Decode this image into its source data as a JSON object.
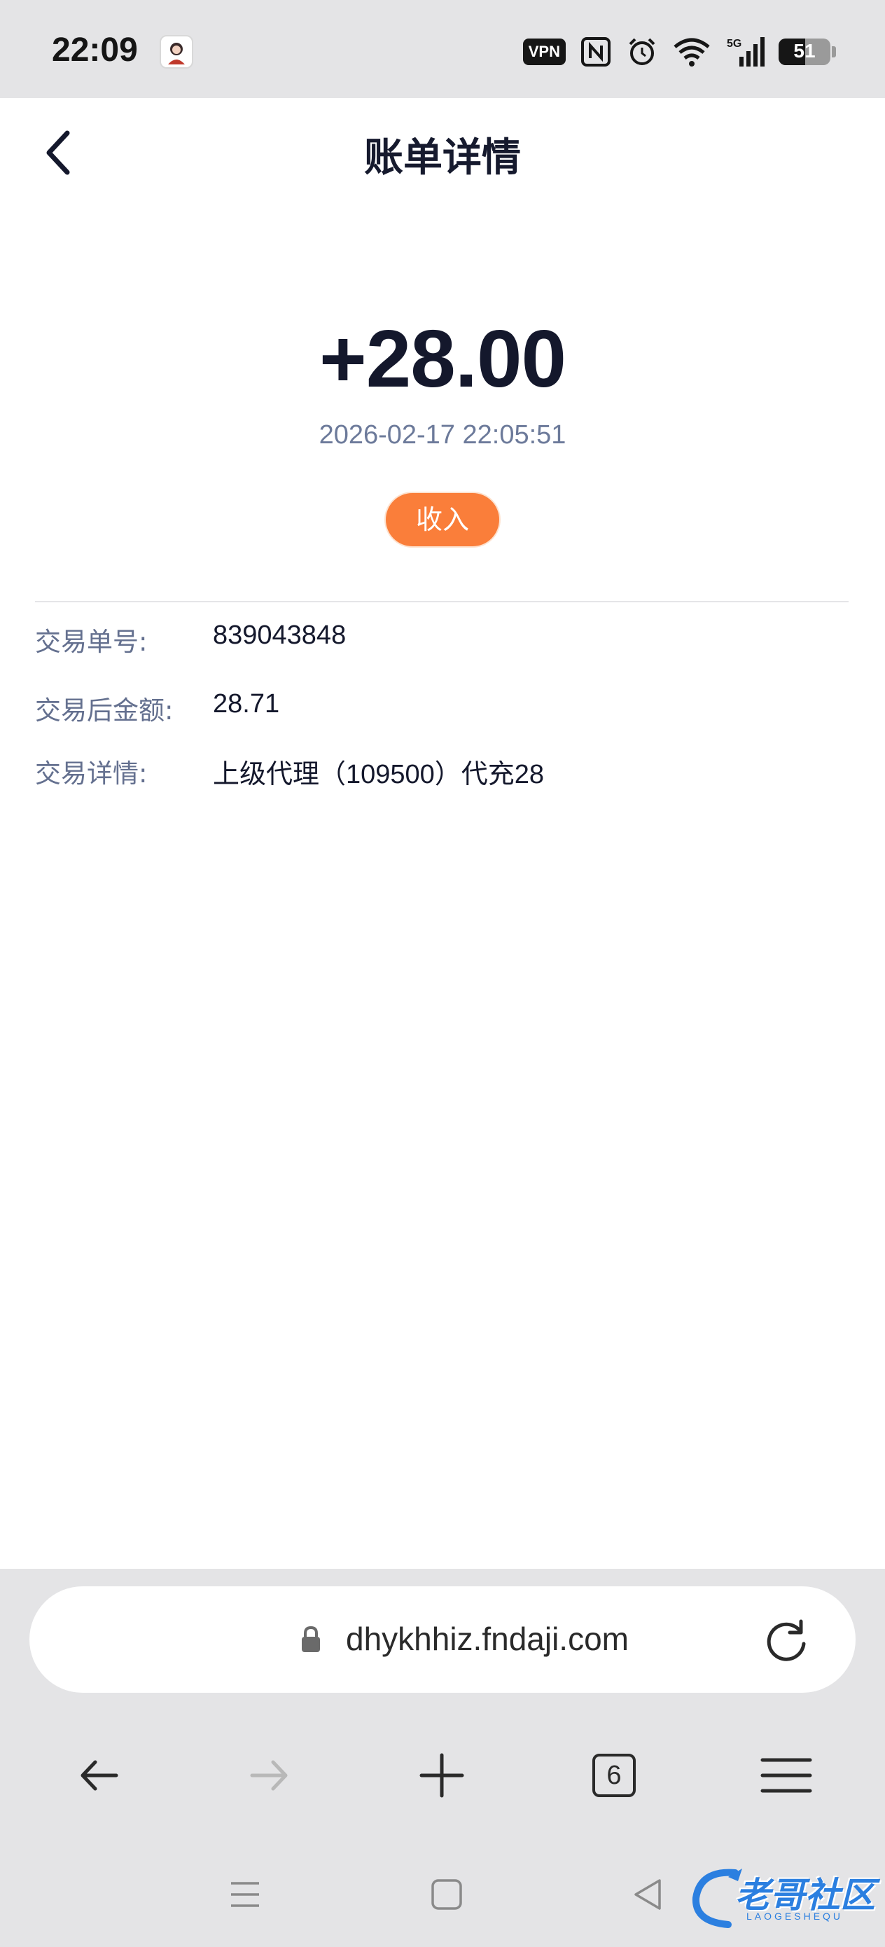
{
  "status_bar": {
    "time": "22:09",
    "vpn": "VPN",
    "network": "5G",
    "battery": "51"
  },
  "header": {
    "title": "账单详情"
  },
  "transaction": {
    "amount": "+28.00",
    "datetime": "2026-02-17 22:05:51",
    "type": "收入"
  },
  "details": [
    {
      "label": "交易单号:",
      "value": "839043848"
    },
    {
      "label": "交易后金额:",
      "value": "28.71"
    },
    {
      "label": "交易详情:",
      "value": "上级代理（109500）代充28"
    }
  ],
  "browser": {
    "url": "dhykhhiz.fndaji.com",
    "tab_count": "6"
  },
  "watermark": {
    "text": "老哥社区",
    "sub": "LAOGESHEQU"
  },
  "colors": {
    "accent": "#fa7e3a",
    "primary_text": "#14182c",
    "label_text": "#64708f",
    "watermark": "#2b7fe0"
  }
}
